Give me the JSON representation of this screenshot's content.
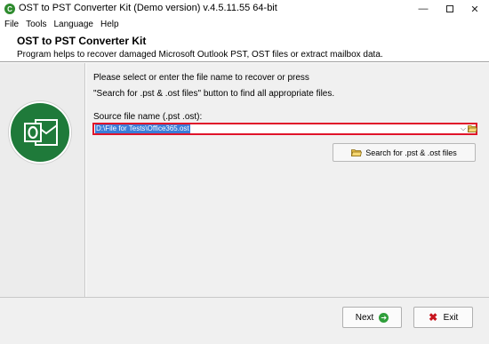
{
  "window": {
    "title": "OST to PST Converter Kit (Demo version) v.4.5.11.55 64-bit",
    "app_icon_glyph": "C",
    "controls": {
      "minimize": "—",
      "maximize": "",
      "close": "✕"
    }
  },
  "menu": [
    "File",
    "Tools",
    "Language",
    "Help"
  ],
  "header": {
    "title": "OST to PST Converter Kit",
    "subtitle": "Program helps to recover damaged Microsoft Outlook PST, OST files or extract mailbox data."
  },
  "main": {
    "prompt_line1": "Please select or enter the file name to recover or press",
    "prompt_line2": "\"Search for .pst & .ost files\" button to find all appropriate files.",
    "source_label": "Source file name (.pst .ost):",
    "source_value": "D:\\File for Tests\\Office365.ost",
    "dropdown_arrow": "⌵",
    "search_button": "Search for .pst & .ost files"
  },
  "footer": {
    "next_label": "Next",
    "exit_label": "Exit",
    "next_icon_glyph": "➔",
    "exit_icon_glyph": "✖"
  },
  "colors": {
    "highlight_border": "#e0142a",
    "selection": "#3b7dd8",
    "logo_green": "#1f7a3a",
    "next_green": "#2f9e3a",
    "exit_red": "#c8141e"
  },
  "icons": {
    "app": "app-logo-icon",
    "logo": "outlook-envelope-icon",
    "browse": "folder-open-icon",
    "search": "folder-search-icon",
    "next": "arrow-right-icon",
    "exit": "close-x-icon"
  }
}
